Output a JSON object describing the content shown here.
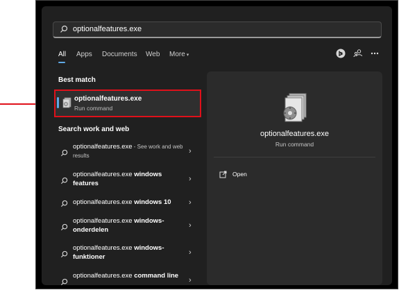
{
  "search": {
    "query": "optionalfeatures.exe"
  },
  "tabs": [
    {
      "label": "All"
    },
    {
      "label": "Apps"
    },
    {
      "label": "Documents"
    },
    {
      "label": "Web"
    },
    {
      "label": "More"
    }
  ],
  "sections": {
    "best_match": "Best match",
    "search_web": "Search work and web"
  },
  "best_match": {
    "title": "optionalfeatures.exe",
    "subtitle": "Run command"
  },
  "web_results": [
    {
      "name": "optionalfeatures.exe",
      "bold": "",
      "muted": " - See work and web results"
    },
    {
      "name": "optionalfeatures.exe ",
      "bold": "windows features",
      "muted": ""
    },
    {
      "name": "optionalfeatures.exe ",
      "bold": "windows 10",
      "muted": ""
    },
    {
      "name": "optionalfeatures.exe ",
      "bold": "windows-onderdelen",
      "muted": ""
    },
    {
      "name": "optionalfeatures.exe ",
      "bold": "windows-funktioner",
      "muted": ""
    },
    {
      "name": "optionalfeatures.exe ",
      "bold": "command line",
      "muted": ""
    }
  ],
  "preview": {
    "title": "optionalfeatures.exe",
    "subtitle": "Run command",
    "action_open": "Open"
  },
  "colors": {
    "accent": "#5fa9e6",
    "highlight": "#e0101a",
    "annotation_arrow": "#e0101a"
  },
  "icons": [
    "search-icon",
    "chevron-down-icon",
    "bing-icon",
    "account-icon",
    "more-icon",
    "app-icon",
    "chevron-right-icon",
    "open-icon",
    "arrow-annotation"
  ]
}
